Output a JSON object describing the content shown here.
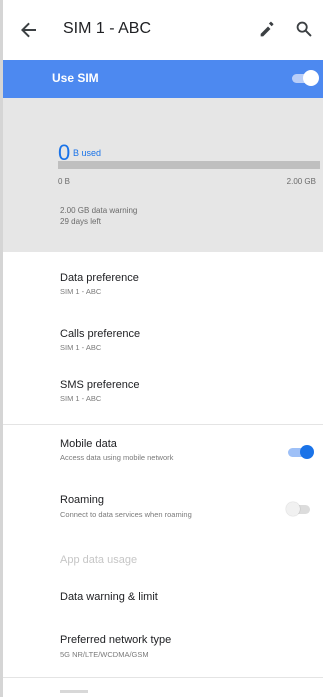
{
  "header": {
    "title": "SIM 1 - ABC"
  },
  "use_sim": {
    "label": "Use SIM",
    "enabled": true
  },
  "usage": {
    "used_value": "0",
    "used_unit": "B used",
    "progress": 0,
    "min_label": "0 B",
    "max_label": "2.00 GB",
    "warning": "2.00 GB data warning",
    "days_left": "29 days left"
  },
  "preferences": [
    {
      "title": "Data preference",
      "subtitle": "SIM 1 - ABC"
    },
    {
      "title": "Calls preference",
      "subtitle": "SIM 1 - ABC"
    },
    {
      "title": "SMS preference",
      "subtitle": "SIM 1 - ABC"
    }
  ],
  "mobile_data": {
    "title": "Mobile data",
    "subtitle": "Access data using mobile network",
    "enabled": true
  },
  "roaming": {
    "title": "Roaming",
    "subtitle": "Connect to data services when roaming",
    "enabled": false
  },
  "app_data_usage": {
    "title": "App data usage"
  },
  "data_warning": {
    "title": "Data warning & limit"
  },
  "network_type": {
    "title": "Preferred network type",
    "subtitle": "5G NR/LTE/WCDMA/GSM"
  },
  "colors": {
    "accent": "#1a73e8",
    "banner": "#4d89f0",
    "usage_bg": "#e6e6e6"
  },
  "icons": [
    "arrow-back-icon",
    "edit-pencil-icon",
    "search-icon"
  ]
}
